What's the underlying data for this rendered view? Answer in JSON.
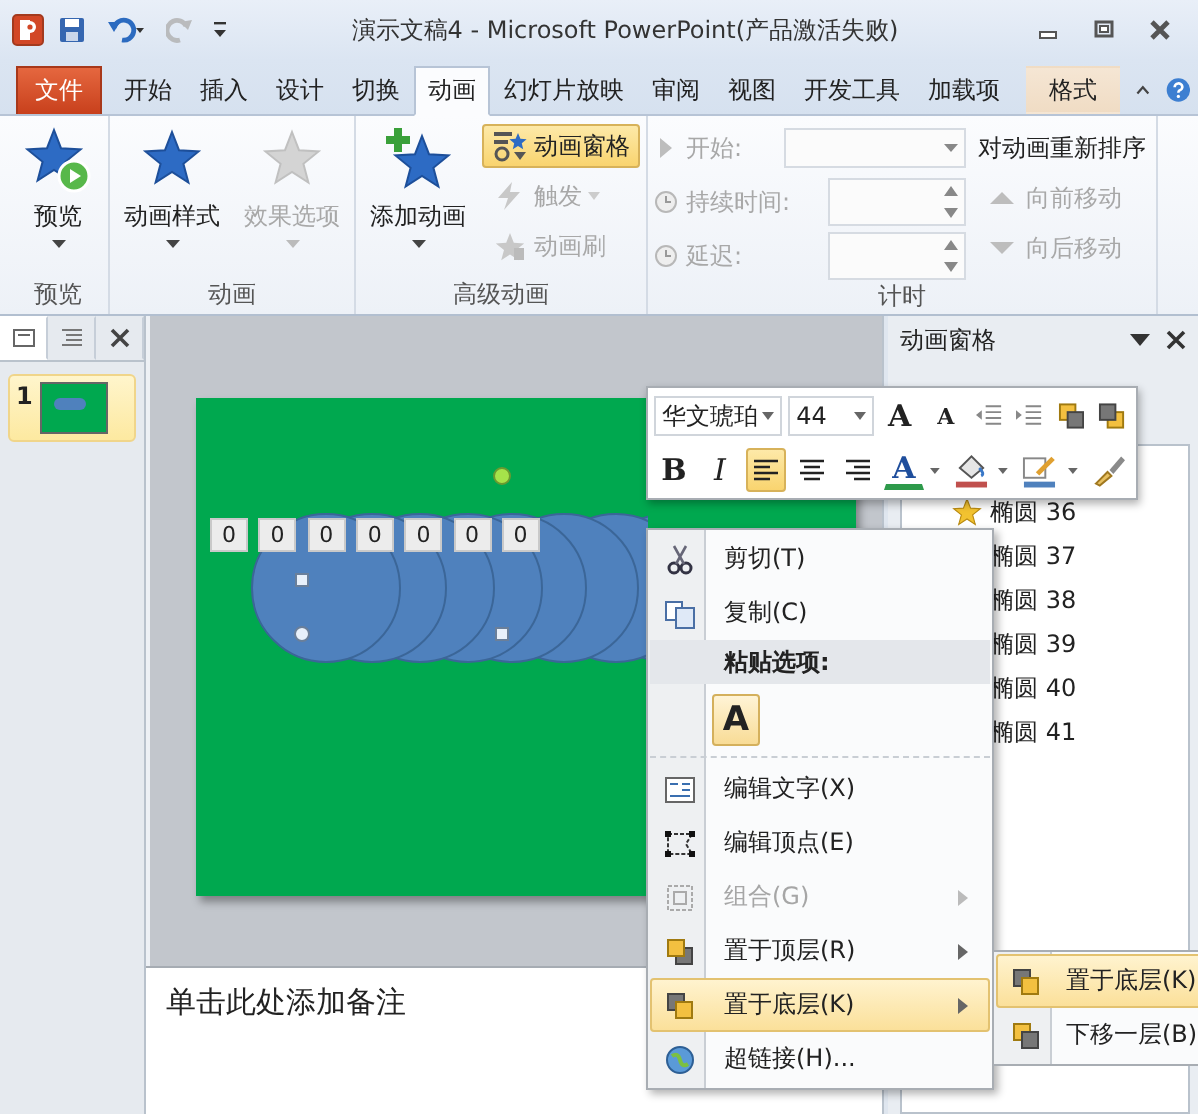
{
  "window": {
    "title": "演示文稿4  -  Microsoft PowerPoint(产品激活失败)"
  },
  "quick_access": [
    {
      "kind": "save",
      "disabled": false
    },
    {
      "kind": "undo",
      "disabled": false
    },
    {
      "kind": "redo",
      "disabled": true
    }
  ],
  "tabs": [
    {
      "label": "文件",
      "kind": "file",
      "selected": false
    },
    {
      "label": "开始",
      "kind": "tab",
      "selected": false
    },
    {
      "label": "插入",
      "kind": "tab",
      "selected": false
    },
    {
      "label": "设计",
      "kind": "tab",
      "selected": false
    },
    {
      "label": "切换",
      "kind": "tab",
      "selected": false
    },
    {
      "label": "动画",
      "kind": "tab",
      "selected": true
    },
    {
      "label": "幻灯片放映",
      "kind": "tab",
      "selected": false
    },
    {
      "label": "审阅",
      "kind": "tab",
      "selected": false
    },
    {
      "label": "视图",
      "kind": "tab",
      "selected": false
    },
    {
      "label": "开发工具",
      "kind": "tab",
      "selected": false
    },
    {
      "label": "加载项",
      "kind": "tab",
      "selected": false
    },
    {
      "label": "格式",
      "kind": "contextual",
      "selected": false
    }
  ],
  "ribbon": {
    "groups": [
      {
        "label": "预览",
        "columns": [
          [
            {
              "kind": "large",
              "label": "预览",
              "dropdown": true,
              "disabled": false
            }
          ]
        ]
      },
      {
        "label": "动画",
        "columns": [
          [
            {
              "kind": "large",
              "label": "动画样式",
              "dropdown": true,
              "disabled": false
            }
          ],
          [
            {
              "kind": "large",
              "label": "效果选项",
              "dropdown": true,
              "disabled": true
            }
          ]
        ]
      },
      {
        "label": "高级动画",
        "columns": [
          [
            {
              "kind": "large",
              "label": "添加动画",
              "dropdown": true,
              "disabled": false
            }
          ],
          [
            {
              "kind": "small",
              "label": "动画窗格",
              "dropdown": false,
              "disabled": false,
              "selected": true
            },
            {
              "kind": "small",
              "label": "触发",
              "dropdown": true,
              "disabled": true,
              "selected": false
            },
            {
              "kind": "small",
              "label": "动画刷",
              "dropdown": false,
              "disabled": true,
              "selected": false
            }
          ]
        ]
      },
      {
        "label": "计时",
        "columns": [
          [
            {
              "kind": "combo",
              "label": "开始:",
              "disabled": true
            },
            {
              "kind": "spinner",
              "label": "持续时间:",
              "disabled": true
            },
            {
              "kind": "spinner",
              "label": "延迟:",
              "disabled": true
            }
          ],
          [
            {
              "kind": "heading",
              "label": "对动画重新排序"
            },
            {
              "kind": "small",
              "label": "向前移动",
              "dropdown": false,
              "disabled": true,
              "selected": false
            },
            {
              "kind": "small",
              "label": "向后移动",
              "dropdown": false,
              "disabled": true,
              "selected": false
            }
          ]
        ]
      }
    ]
  },
  "slides_pane": {
    "tabs": [
      {
        "kind": "slides",
        "selected": true
      },
      {
        "kind": "outline",
        "selected": false
      }
    ],
    "thumbnails": [
      {
        "number": "1",
        "selected": true
      }
    ]
  },
  "slide": {
    "tags": [
      "0",
      "0",
      "0",
      "0",
      "0",
      "0",
      "0"
    ]
  },
  "notes": {
    "text": "单击此处添加备注"
  },
  "animation_pane": {
    "title": "动画窗格",
    "items": [
      {
        "label": "椭圆 36"
      },
      {
        "label": "椭圆 37"
      },
      {
        "label": "椭圆 38"
      },
      {
        "label": "椭圆 39"
      },
      {
        "label": "椭圆 40"
      },
      {
        "label": "椭圆 41"
      }
    ]
  },
  "mini_toolbar": {
    "font": "华文琥珀",
    "size": "44",
    "row1": [
      {
        "kind": "grow",
        "label": "A"
      },
      {
        "kind": "shrink",
        "label": "A"
      },
      {
        "kind": "outdent"
      },
      {
        "kind": "indent"
      },
      {
        "kind": "forward"
      },
      {
        "kind": "backward"
      }
    ],
    "row2": [
      {
        "kind": "bold",
        "label": "B"
      },
      {
        "kind": "italic",
        "label": "I"
      },
      {
        "kind": "align-left",
        "selected": true
      },
      {
        "kind": "align-center",
        "selected": false
      },
      {
        "kind": "align-right",
        "selected": false
      },
      {
        "kind": "font-color",
        "label": "A"
      },
      {
        "kind": "fill"
      },
      {
        "kind": "outline"
      },
      {
        "kind": "painter"
      }
    ]
  },
  "context_menu": {
    "items": [
      {
        "kind": "item",
        "label": "剪切(T)",
        "disabled": false,
        "submenu": false,
        "selected": false
      },
      {
        "kind": "item",
        "label": "复制(C)",
        "disabled": false,
        "submenu": false,
        "selected": false
      },
      {
        "kind": "header",
        "label": "粘贴选项:"
      },
      {
        "kind": "paste",
        "label": "A"
      },
      {
        "kind": "item",
        "label": "编辑文字(X)",
        "disabled": false,
        "submenu": false,
        "selected": false
      },
      {
        "kind": "item",
        "label": "编辑顶点(E)",
        "disabled": false,
        "submenu": false,
        "selected": false
      },
      {
        "kind": "item",
        "label": "组合(G)",
        "disabled": true,
        "submenu": true,
        "selected": false
      },
      {
        "kind": "item",
        "label": "置于顶层(R)",
        "disabled": false,
        "submenu": true,
        "selected": false
      },
      {
        "kind": "item",
        "label": "置于底层(K)",
        "disabled": false,
        "submenu": true,
        "selected": true
      },
      {
        "kind": "item",
        "label": "超链接(H)...",
        "disabled": false,
        "submenu": false,
        "selected": false
      }
    ],
    "submenu": [
      {
        "label": "置于底层(K)",
        "selected": true
      },
      {
        "label": "下移一层(B)",
        "selected": false
      }
    ]
  }
}
